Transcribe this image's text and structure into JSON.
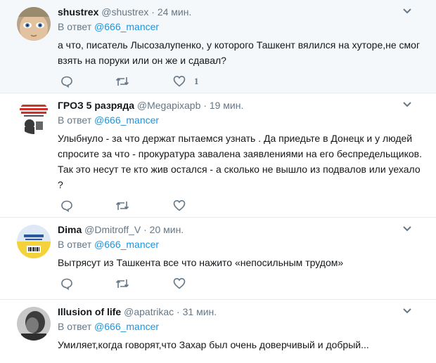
{
  "tweets": [
    {
      "name": "shustrex",
      "handle": "@shustrex",
      "time": "24 мин.",
      "reply_prefix": "В ответ",
      "reply_to": "@666_mancer",
      "text": "а что, писатель Лысозалупенко, у которого Ташкент вялился на хуторе,не смог взять на поруки или он же и сдавал?",
      "like_count": "1"
    },
    {
      "name": "ГРОЗ 5 разряда",
      "handle": "@Megapixapb",
      "time": "19 мин.",
      "reply_prefix": "В ответ",
      "reply_to": "@666_mancer",
      "text": "Улыбнуло - за что держат пытаемся узнать . Да приедьте в Донецк и у людей спросите за что - прокуратура завалена заявлениями на его беспредельщиков. Так это несут те кто жив остался - а сколько не вышло из подвалов или уехало ?",
      "like_count": ""
    },
    {
      "name": "Dima",
      "handle": "@Dmitroff_V",
      "time": "20 мин.",
      "reply_prefix": "В ответ",
      "reply_to": "@666_mancer",
      "text": "Вытрясут из Ташкента все что нажито «непосильным трудом»",
      "like_count": ""
    },
    {
      "name": "Illusion of life",
      "handle": "@apatrikac",
      "time": "31 мин.",
      "reply_prefix": "В ответ",
      "reply_to": "@666_mancer",
      "text": "Умиляет,когда говорят,что Захар был очень доверчивый и добрый...",
      "like_count": ""
    }
  ],
  "dot": "·",
  "icons": {
    "caret": "chevron-down-icon",
    "reply": "reply-icon",
    "retweet": "retweet-icon",
    "like": "heart-icon"
  },
  "colors": {
    "link": "#1b95e0",
    "muted": "#657786",
    "highlight_bg": "#f5f8fa",
    "border": "#e6ecf0"
  }
}
